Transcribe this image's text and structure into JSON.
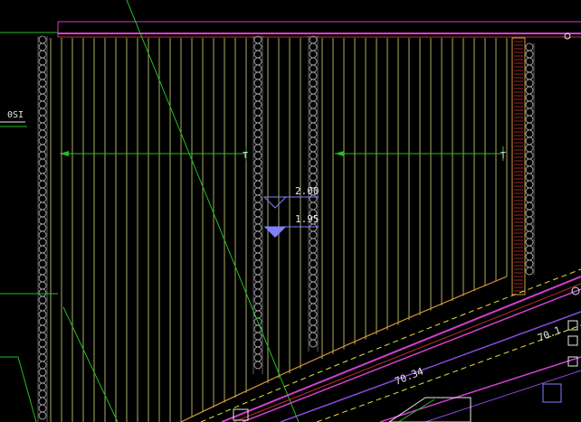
{
  "drawing": {
    "background": "#000000",
    "colors": {
      "hatch": "#d7d77a",
      "hatch_orange": "#d89a3c",
      "pile": "#b8b8b8",
      "magenta": "#d040d0",
      "green": "#22c022",
      "white": "#e8e8e8",
      "red": "#c03030",
      "blue_marker": "#8080ff",
      "purple": "#8a4ae0",
      "yellow_dash": "#e8e040"
    },
    "labels": {
      "left_tag": "0SI",
      "elev_upper": "2.00",
      "elev_lower": "1.95",
      "mid_label": "70.34",
      "lower_right_label": "70.1",
      "dim_left_end": "T",
      "dim_right_end": "T"
    },
    "icons": {
      "elev_marker_open": "open-triangle-elevation-icon",
      "elev_marker_filled": "filled-triangle-elevation-icon",
      "dim_arrow": "dimension-arrow-icon",
      "corner_circle": "circle-node-icon"
    }
  }
}
